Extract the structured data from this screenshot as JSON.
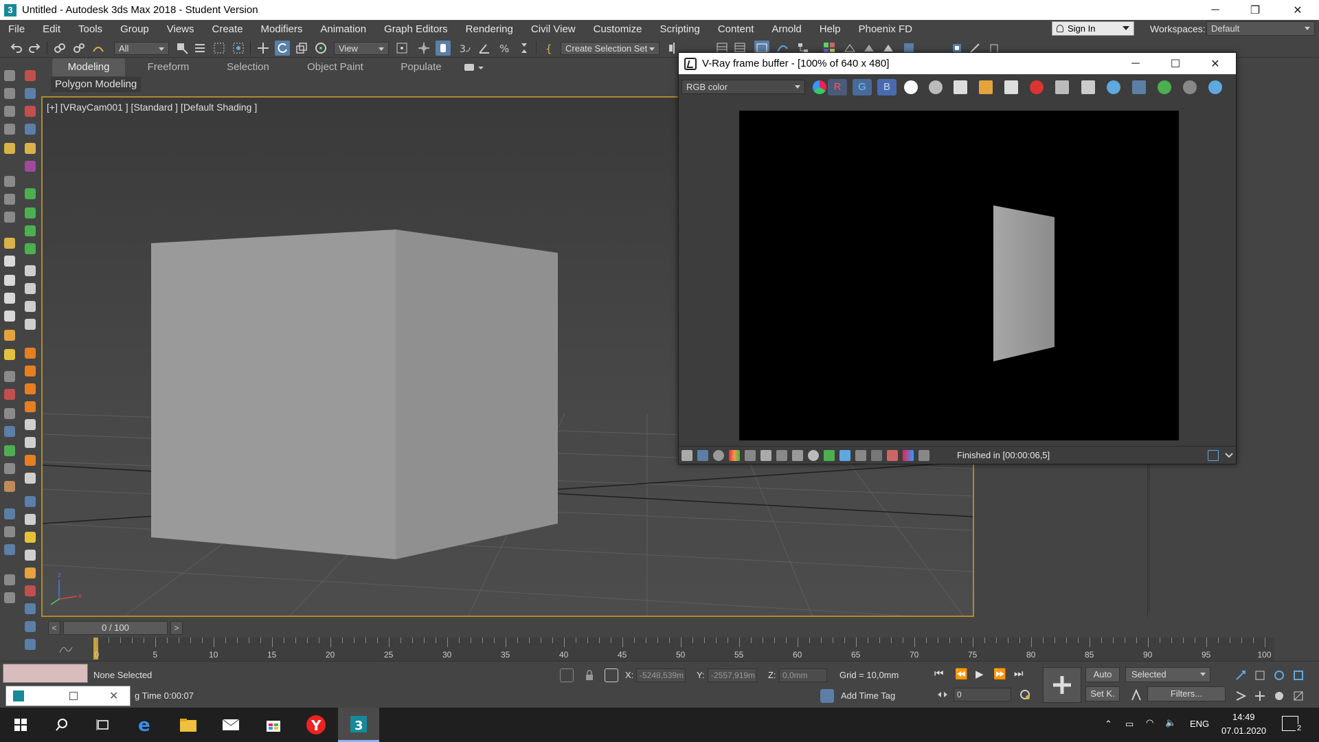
{
  "app": {
    "title": "Untitled - Autodesk 3ds Max 2018 - Student Version",
    "icon_letter": "3",
    "window_controls": [
      "─",
      "❐",
      "✕"
    ]
  },
  "menu": {
    "items": [
      "File",
      "Edit",
      "Tools",
      "Group",
      "Views",
      "Create",
      "Modifiers",
      "Animation",
      "Graph Editors",
      "Rendering",
      "Civil View",
      "Customize",
      "Scripting",
      "Content",
      "Arnold",
      "Help",
      "Phoenix FD"
    ],
    "sign_in": "Sign In",
    "workspaces_label": "Workspaces:",
    "workspace_value": "Default"
  },
  "toolbar": {
    "filter_value": "All",
    "refcoord_value": "View",
    "selection_set_value": "Create Selection Set"
  },
  "ribbon": {
    "tabs": [
      "Modeling",
      "Freeform",
      "Selection",
      "Object Paint",
      "Populate"
    ],
    "active_tab": "Modeling",
    "panel_label": "Polygon Modeling"
  },
  "viewport": {
    "label": "[+] [VRayCam001 ] [Standard ] [Default Shading ]",
    "axis_z": "z",
    "axis_x": "x",
    "accent": "#b08a2e"
  },
  "vfb": {
    "title": "V-Ray frame buffer - [100% of 640 x 480]",
    "channel_value": "RGB color",
    "r_label": "R",
    "g_label": "G",
    "b_label": "B",
    "status_text": "Finished in [00:00:06,5]",
    "window_controls": [
      "─",
      "☐",
      "✕"
    ]
  },
  "timeline": {
    "frame_readout": "0 / 100",
    "prev_label": "<",
    "next_label": ">",
    "tick_labels": [
      "0",
      "5",
      "10",
      "15",
      "20",
      "25",
      "30",
      "35",
      "40",
      "45",
      "50",
      "55",
      "60",
      "65",
      "70",
      "75",
      "80",
      "85",
      "90",
      "95",
      "100"
    ]
  },
  "status": {
    "selection_text": "None Selected",
    "time_text": "g Time  0:00:07",
    "x_label": "X:",
    "x_value": "-5248,539m",
    "y_label": "Y:",
    "y_value": "-2557,919m",
    "z_label": "Z:",
    "z_value": "0,0mm",
    "grid_text": "Grid = 10,0mm",
    "add_time_tag": "Add Time Tag",
    "auto_label": "Auto",
    "selected_value": "Selected",
    "setk_label": "Set K.",
    "filters_label": "Filters...",
    "frame_value": "0"
  },
  "taskbar": {
    "language": "ENG",
    "time": "14:49",
    "date": "07.01.2020",
    "notifications": "2"
  }
}
